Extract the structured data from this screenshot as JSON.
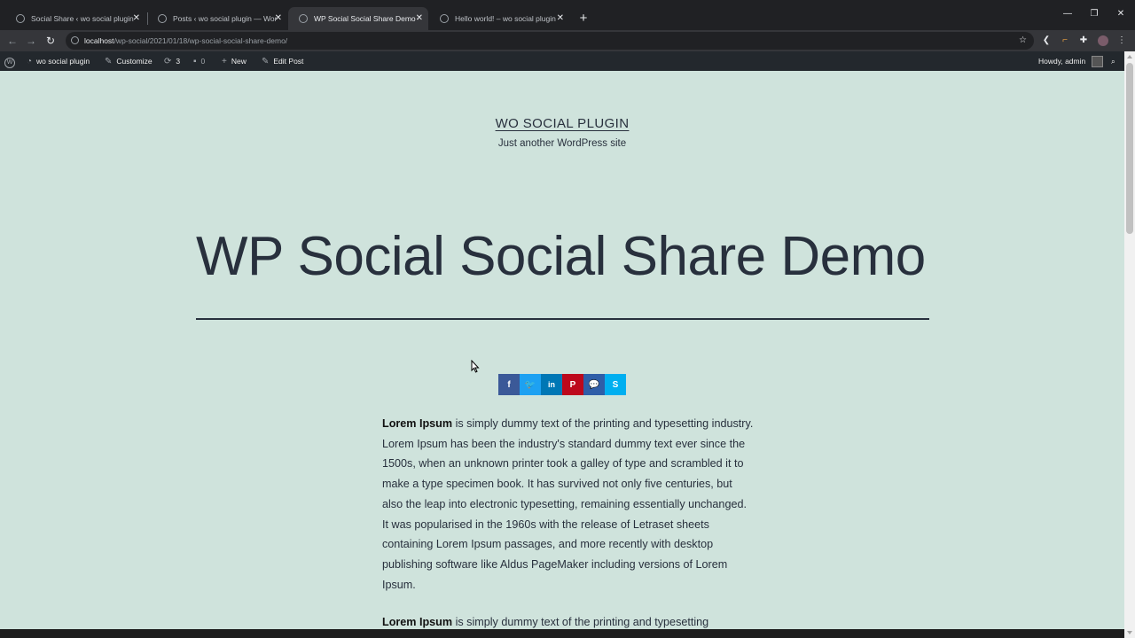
{
  "browser": {
    "tabs": [
      {
        "title": "Social Share ‹ wo social plugin — WordPress",
        "active": false
      },
      {
        "title": "Posts ‹ wo social plugin — WordPress",
        "active": false
      },
      {
        "title": "WP Social Social Share Demo – wo social plugin",
        "active": true
      },
      {
        "title": "Hello world! – wo social plugin",
        "active": false
      }
    ],
    "new_tab": "+",
    "url_host": "localhost",
    "url_path": "/wp-social/2021/01/18/wp-social-social-share-demo/"
  },
  "adminbar": {
    "site_name": "wo social plugin",
    "customize": "Customize",
    "updates_count": "3",
    "comments_count": "0",
    "new_label": "New",
    "edit_post": "Edit Post",
    "howdy": "Howdy, admin"
  },
  "site": {
    "title": "WO SOCIAL PLUGIN",
    "tagline": "Just another WordPress site"
  },
  "post": {
    "title": "WP Social Social Share Demo",
    "paragraphs": [
      {
        "bold": "Lorem Ipsum",
        "text": " is simply dummy text of the printing and typesetting industry. Lorem Ipsum has been the industry's standard dummy text ever since the 1500s, when an unknown printer took a galley of type and scrambled it to make a type specimen book. It has survived not only five centuries, but also the leap into electronic typesetting, remaining essentially unchanged. It was popularised in the 1960s with the release of Letraset sheets containing Lorem Ipsum passages, and more recently with desktop publishing software like Aldus PageMaker including versions of Lorem Ipsum."
      },
      {
        "bold": "Lorem Ipsum",
        "text": " is simply dummy text of the printing and typesetting"
      }
    ]
  },
  "share_buttons": [
    {
      "network": "facebook",
      "icon": "facebook-icon",
      "glyph": "f",
      "color": "#3b5998"
    },
    {
      "network": "twitter",
      "icon": "twitter-icon",
      "glyph": "🐦",
      "color": "#1da1f2"
    },
    {
      "network": "linkedin",
      "icon": "linkedin-icon",
      "glyph": "in",
      "color": "#0077b5"
    },
    {
      "network": "pinterest",
      "icon": "pinterest-icon",
      "glyph": "P",
      "color": "#bd081c"
    },
    {
      "network": "messenger",
      "icon": "messenger-icon",
      "glyph": "💬",
      "color": "#2f5ea8"
    },
    {
      "network": "skype",
      "icon": "skype-icon",
      "glyph": "S",
      "color": "#00aff0"
    }
  ]
}
